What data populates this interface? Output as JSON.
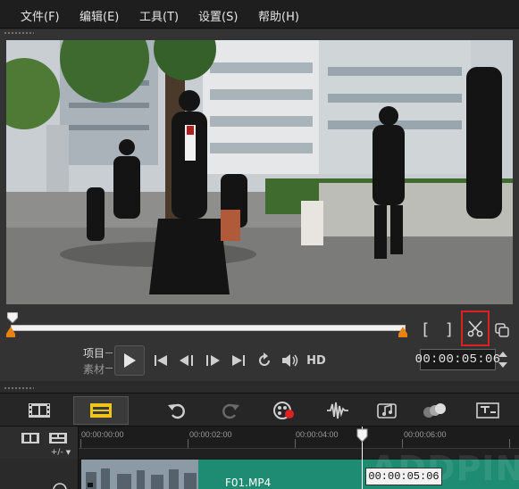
{
  "menu": {
    "items": [
      "文件(F)",
      "编辑(E)",
      "工具(T)",
      "设置(S)",
      "帮助(H)"
    ]
  },
  "player": {
    "progress": 0.0,
    "mode_project": "项目",
    "mode_clip": "素材",
    "hd_label": "HD",
    "timecode": "00:00:05:06",
    "mark_in_label": "[",
    "mark_out_label": "]"
  },
  "timeline": {
    "ruler": [
      "00:00:00:00",
      "00:00:02:00",
      "00:00:04:00",
      "00:00:06:00"
    ],
    "edit_mode": "+/-",
    "clip_label": "F01.MP4",
    "playhead_timecode": "00:00:05:06",
    "watermark": "ADDPIN.COM"
  },
  "colors": {
    "accent_red": "#e02020",
    "clip_green": "#1e8c72",
    "marker_orange": "#e8820f",
    "toolbar_yellow": "#f0c419"
  }
}
